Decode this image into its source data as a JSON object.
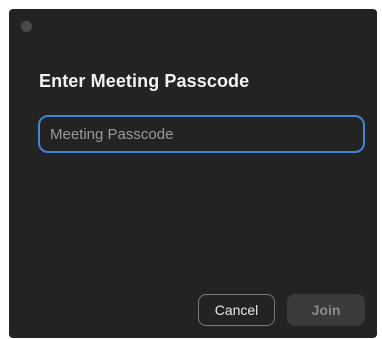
{
  "dialog": {
    "title": "Enter Meeting Passcode",
    "passcode_input": {
      "value": "",
      "placeholder": "Meeting Passcode"
    },
    "cancel_label": "Cancel",
    "join_label": "Join"
  },
  "colors": {
    "background": "#232323",
    "input_focus_border": "#3f86d9",
    "disabled_button": "#3a3a3a"
  }
}
